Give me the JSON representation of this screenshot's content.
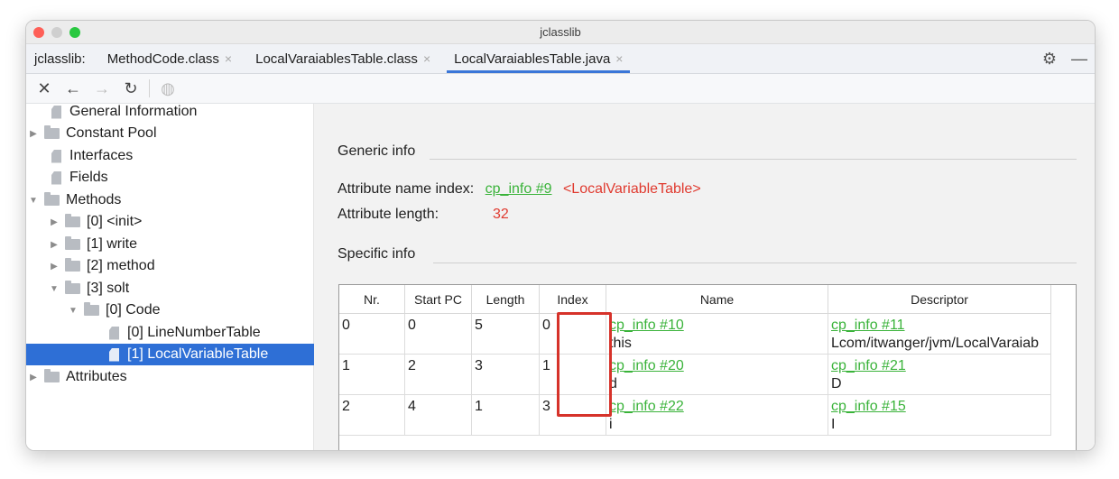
{
  "window": {
    "title": "jclasslib"
  },
  "tabs_bar": {
    "app_label": "jclasslib:",
    "tabs": [
      {
        "label": "MethodCode.class",
        "close": "×"
      },
      {
        "label": "LocalVaraiablesTable.class",
        "close": "×"
      },
      {
        "label": "LocalVaraiablesTable.java",
        "close": "×",
        "active": true
      }
    ],
    "settings_icon": "gear-icon",
    "minimize_icon": "minus-icon"
  },
  "toolbar": {
    "close_icon": "✕",
    "back_icon": "←",
    "forward_icon": "→",
    "reload_icon": "↻",
    "web_icon": "◍"
  },
  "tree": [
    {
      "label": "General Information",
      "type": "file",
      "arrow": ""
    },
    {
      "label": "Constant Pool",
      "type": "folder",
      "arrow": "▶"
    },
    {
      "label": "Interfaces",
      "type": "file",
      "arrow": ""
    },
    {
      "label": "Fields",
      "type": "file",
      "arrow": ""
    },
    {
      "label": "Methods",
      "type": "folder",
      "arrow": "▼"
    },
    {
      "label": "[0] <init>",
      "type": "folder",
      "arrow": "▶"
    },
    {
      "label": "[1] write",
      "type": "folder",
      "arrow": "▶"
    },
    {
      "label": "[2] method",
      "type": "folder",
      "arrow": "▶"
    },
    {
      "label": "[3] solt",
      "type": "folder",
      "arrow": "▼"
    },
    {
      "label": "[0] Code",
      "type": "folder",
      "arrow": "▼"
    },
    {
      "label": "[0] LineNumberTable",
      "type": "file",
      "arrow": ""
    },
    {
      "label": "[1] LocalVariableTable",
      "type": "file",
      "arrow": "",
      "selected": true
    },
    {
      "label": "Attributes",
      "type": "folder",
      "arrow": "▶"
    }
  ],
  "generic": {
    "title": "Generic info",
    "name_index_label": "Attribute name index:",
    "name_index_link": "cp_info #9",
    "name_index_value": "<LocalVariableTable>",
    "length_label": "Attribute length:",
    "length_value": "32"
  },
  "specific": {
    "title": "Specific info",
    "columns": [
      "Nr.",
      "Start PC",
      "Length",
      "Index",
      "Name",
      "Descriptor"
    ],
    "rows": [
      {
        "nr": "0",
        "start_pc": "0",
        "length": "5",
        "index": "0",
        "name_link": "cp_info #10",
        "name_value": "this",
        "desc_link": "cp_info #11",
        "desc_value": "Lcom/itwanger/jvm/LocalVaraiab"
      },
      {
        "nr": "1",
        "start_pc": "2",
        "length": "3",
        "index": "1",
        "name_link": "cp_info #20",
        "name_value": "d",
        "desc_link": "cp_info #21",
        "desc_value": "D"
      },
      {
        "nr": "2",
        "start_pc": "4",
        "length": "1",
        "index": "3",
        "name_link": "cp_info #22",
        "name_value": "i",
        "desc_link": "cp_info #15",
        "desc_value": "I"
      }
    ]
  }
}
